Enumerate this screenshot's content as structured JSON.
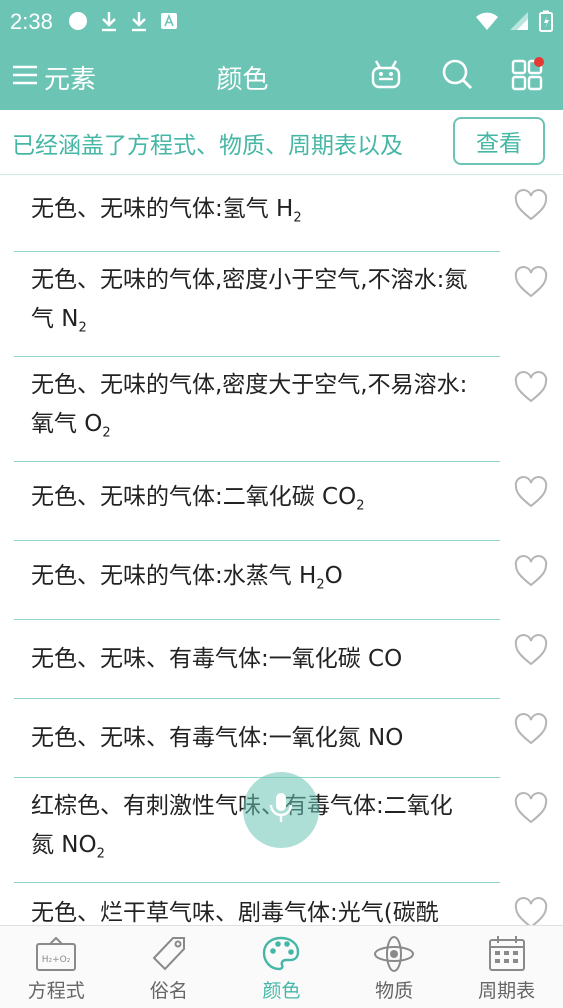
{
  "status_bar": {
    "time": "2:38"
  },
  "app_bar": {
    "menu_label": "元素",
    "title": "颜色"
  },
  "notice": {
    "text": "已经涵盖了方程式、物质、周期表以及",
    "button": "查看"
  },
  "items": [
    {
      "text": "无色、无味的气体:氢气 H",
      "sub": "2",
      "tail": ""
    },
    {
      "text": "无色、无味的气体,密度小于空气,不溶水:氮气 N",
      "sub": "2",
      "tail": ""
    },
    {
      "text": "无色、无味的气体,密度大于空气,不易溶水:氧气 O",
      "sub": "2",
      "tail": ""
    },
    {
      "text": "无色、无味的气体:二氧化碳 CO",
      "sub": "2",
      "tail": ""
    },
    {
      "text": "无色、无味的气体:水蒸气 H",
      "sub": "2",
      "tail": "O"
    },
    {
      "text": "无色、无味、有毒气体:一氧化碳 CO",
      "sub": "",
      "tail": ""
    },
    {
      "text": "无色、无味、有毒气体:一氧化氮 NO",
      "sub": "",
      "tail": ""
    },
    {
      "text": "红棕色、有刺激性气味、有毒气体:二氧化氮 NO",
      "sub": "2",
      "tail": ""
    },
    {
      "text": "无色、烂干草气味、剧毒气体:光气(碳酰",
      "sub": "",
      "tail": ""
    }
  ],
  "tabs": [
    {
      "label": "方程式",
      "icon": "equation-board-icon",
      "active": false
    },
    {
      "label": "俗名",
      "icon": "tag-icon",
      "active": false
    },
    {
      "label": "颜色",
      "icon": "palette-icon",
      "active": true
    },
    {
      "label": "物质",
      "icon": "atom-icon",
      "active": false
    },
    {
      "label": "周期表",
      "icon": "calendar-grid-icon",
      "active": false
    }
  ],
  "tab_icon_text": {
    "equation": "H₂+O₂"
  },
  "colors": {
    "primary": "#6cc4b5",
    "accent_text": "#46b7a6",
    "divider": "#8fd4c8",
    "badge": "#e53935"
  }
}
